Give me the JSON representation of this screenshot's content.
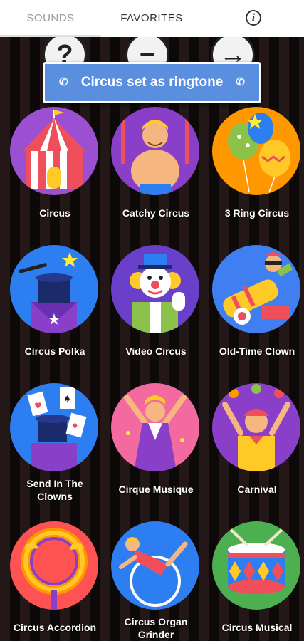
{
  "tabs": {
    "sounds": "SOUNDS",
    "favorites": "FAVORITES",
    "info_icon": "i"
  },
  "top_icons": [
    "?",
    "−",
    "→"
  ],
  "toast": {
    "text": "Circus set as ringtone",
    "icon": "phone-icon"
  },
  "sounds": [
    {
      "label": "Circus",
      "bg": "#9b4fd1",
      "icon": "circus-tent-icon"
    },
    {
      "label": "Catchy Circus",
      "bg": "#8a3fc9",
      "icon": "strongman-icon"
    },
    {
      "label": "3 Ring Circus",
      "bg": "#ff9800",
      "icon": "balloons-icon"
    },
    {
      "label": "Circus Polka",
      "bg": "#2d7ef0",
      "icon": "magic-hat-icon"
    },
    {
      "label": "Video Circus",
      "bg": "#6a3fc9",
      "icon": "clown-icon"
    },
    {
      "label": "Old-Time Clown",
      "bg": "#3f7ff2",
      "icon": "cannon-icon"
    },
    {
      "label": "Send In The\nClowns",
      "bg": "#2d7ef0",
      "icon": "playing-cards-icon"
    },
    {
      "label": "Cirque Musique",
      "bg": "#f26aa0",
      "icon": "acrobat-icon"
    },
    {
      "label": "Carnival",
      "bg": "#8a3fc9",
      "icon": "juggler-icon"
    },
    {
      "label": "Circus Accordion",
      "bg": "#ff5252",
      "icon": "fire-ring-icon"
    },
    {
      "label": "Circus Organ\nGrinder",
      "bg": "#2d7ef0",
      "icon": "trapeze-icon"
    },
    {
      "label": "Circus Musical",
      "bg": "#4caf50",
      "icon": "drum-icon"
    }
  ]
}
